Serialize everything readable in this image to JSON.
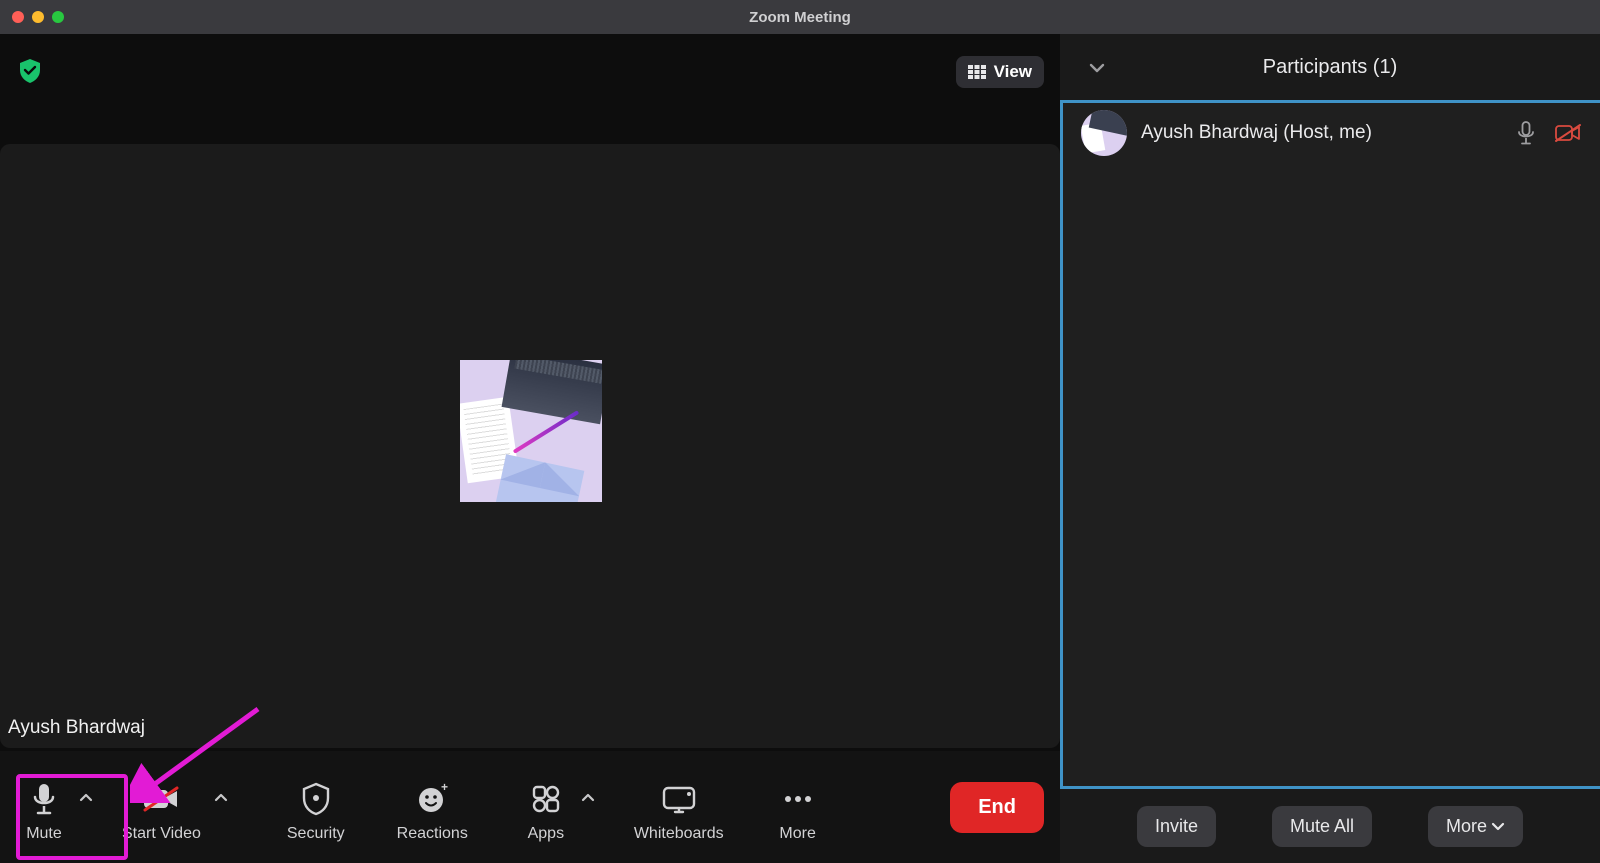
{
  "window": {
    "title": "Zoom Meeting"
  },
  "view_button": {
    "label": "View"
  },
  "video": {
    "display_name": "Ayush Bhardwaj"
  },
  "toolbar": {
    "mute": "Mute",
    "start_video": "Start Video",
    "security": "Security",
    "reactions": "Reactions",
    "apps": "Apps",
    "whiteboards": "Whiteboards",
    "more": "More",
    "end": "End"
  },
  "participants": {
    "header": "Participants (1)",
    "list": [
      {
        "name": "Ayush Bhardwaj (Host, me)"
      }
    ],
    "footer": {
      "invite": "Invite",
      "mute_all": "Mute All",
      "more": "More"
    }
  }
}
